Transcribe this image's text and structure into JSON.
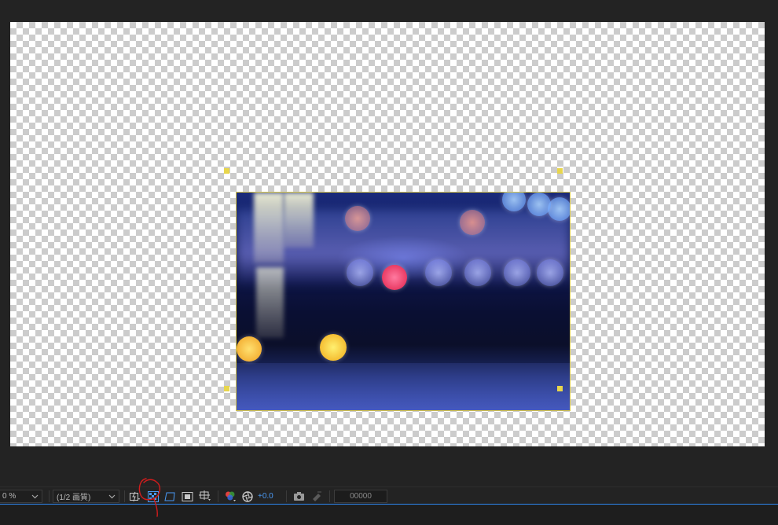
{
  "composition": {
    "viewer_background": "transparency-checkerboard",
    "layer_bounds_color": "#d9c84a"
  },
  "toolbar": {
    "magnification": {
      "value": "0 %",
      "icon": "chevron-down-icon"
    },
    "resolution": {
      "value": "(1/2 画質)",
      "icon": "chevron-down-icon"
    },
    "buttons": [
      {
        "name": "fast-previews-button",
        "icon": "fast-previews-icon"
      },
      {
        "name": "transparency-grid-button",
        "icon": "transparency-grid-icon",
        "active": true
      },
      {
        "name": "mask-path-visibility-button",
        "icon": "mask-path-icon"
      },
      {
        "name": "region-of-interest-button",
        "icon": "region-of-interest-icon"
      },
      {
        "name": "grid-guides-button",
        "icon": "grid-guides-icon"
      },
      {
        "name": "show-channel-button",
        "icon": "rgb-channel-icon"
      },
      {
        "name": "reset-exposure-button",
        "icon": "exposure-icon"
      }
    ],
    "exposure_value": "+0.0",
    "snapshot_icon": "camera-icon",
    "show_snapshot_icon": "show-snapshot-icon",
    "timecode": "00000",
    "accent_color": "#2d86f0"
  }
}
